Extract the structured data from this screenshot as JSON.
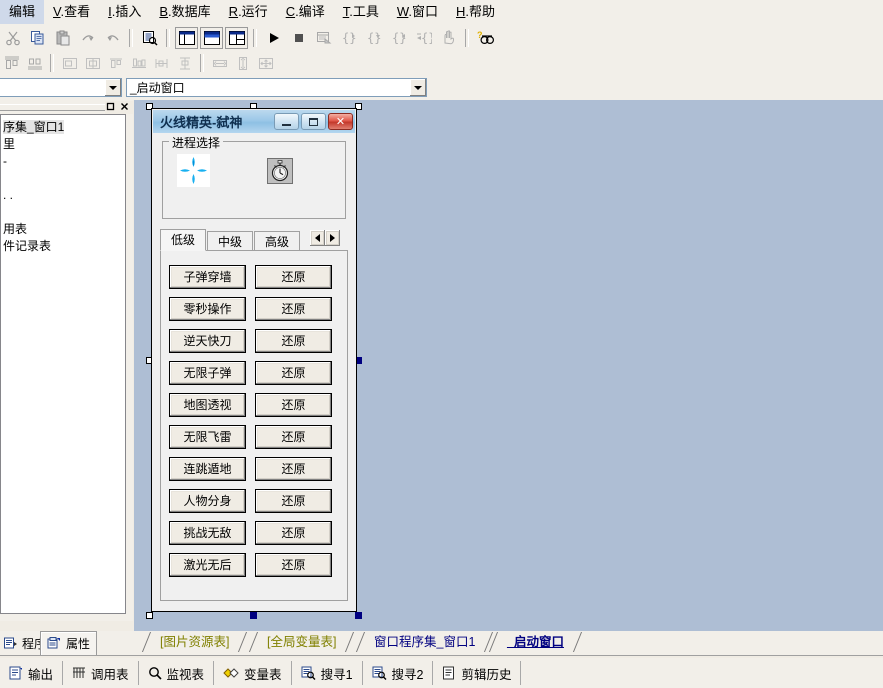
{
  "menu": {
    "items": [
      {
        "mnemonic": "",
        "label": "编辑"
      },
      {
        "mnemonic": "V",
        "label": ".查看"
      },
      {
        "mnemonic": "I",
        "label": ".插入"
      },
      {
        "mnemonic": "B",
        "label": ".数据库"
      },
      {
        "mnemonic": "R",
        "label": ".运行"
      },
      {
        "mnemonic": "C",
        "label": ".编译"
      },
      {
        "mnemonic": "T",
        "label": ".工具"
      },
      {
        "mnemonic": "W",
        "label": ".窗口"
      },
      {
        "mnemonic": "H",
        "label": ".帮助"
      }
    ]
  },
  "toolbar1": {
    "icons": [
      "cut-icon",
      "copy-icon",
      "paste-icon",
      "redo-icon",
      "undo-icon",
      "sep",
      "find-in-file-icon",
      "sep",
      "layout-left-icon",
      "layout-top-icon",
      "layout-grid-icon",
      "sep",
      "run-icon",
      "stop-icon",
      "debug-window-icon",
      "step-into-icon",
      "step-over-icon",
      "step-out-icon",
      "run-to-cursor-icon",
      "pause-hand-icon",
      "sep",
      "find-next-icon"
    ]
  },
  "toolbar2": {
    "icons": [
      "align-tops-icon",
      "align-centers-icon",
      "sep",
      "align-left-icon",
      "align-center-h-icon",
      "align-top-icon",
      "align-bottom-icon",
      "space-h-icon",
      "space-v-icon",
      "sep",
      "same-width-icon",
      "same-height-icon",
      "same-size-icon"
    ]
  },
  "combos": {
    "left": {
      "value": "",
      "placeholder": ""
    },
    "right": {
      "value": "_启动窗口"
    }
  },
  "left_panel": {
    "caption_buttons": [
      "maximize-icon",
      "close-icon"
    ],
    "tree_items": [
      {
        "label": "序集_窗口1",
        "highlight": true
      },
      {
        "label": "里",
        "highlight": false
      },
      {
        "label": "-",
        "highlight": false
      },
      {
        "label": "",
        "highlight": false
      },
      {
        "label": " . .",
        "highlight": false
      },
      {
        "label": "",
        "highlight": false
      },
      {
        "label": "用表",
        "highlight": false
      },
      {
        "label": "件记录表",
        "highlight": false
      }
    ]
  },
  "form": {
    "title": "火线精英-弑神",
    "window_buttons": [
      "minimize-icon",
      "maximize-icon",
      "close-icon"
    ],
    "groupbox_label": "进程选择",
    "groupbox_icons": [
      "process-diamond-icon",
      "stopwatch-icon"
    ],
    "tabs": [
      {
        "label": "低级",
        "active": true
      },
      {
        "label": "中级",
        "active": false
      },
      {
        "label": "高级",
        "active": false
      }
    ],
    "tab_spinner": [
      "spin-left-icon",
      "spin-right-icon"
    ],
    "rows": [
      {
        "action": "子弹穿墙",
        "restore": "还原"
      },
      {
        "action": "零秒操作",
        "restore": "还原"
      },
      {
        "action": "逆天快刀",
        "restore": "还原"
      },
      {
        "action": "无限子弹",
        "restore": "还原"
      },
      {
        "action": "地图透视",
        "restore": "还原"
      },
      {
        "action": "无限飞雷",
        "restore": "还原"
      },
      {
        "action": "连跳遁地",
        "restore": "还原"
      },
      {
        "action": "人物分身",
        "restore": "还原"
      },
      {
        "action": "挑战无敌",
        "restore": "还原"
      },
      {
        "action": "激光无后",
        "restore": "还原"
      }
    ]
  },
  "bottom_left_tabs": [
    {
      "label": "程序",
      "icon": "program-icon",
      "active": false
    },
    {
      "label": "属性",
      "icon": "properties-icon",
      "active": true
    }
  ],
  "document_tabs": [
    {
      "label": "[图片资源表]",
      "color": "#808000",
      "active": false
    },
    {
      "label": "[全局变量表]",
      "color": "#808000",
      "active": false
    },
    {
      "label": "窗口程序集_窗口1",
      "color": "#000080",
      "active": false
    },
    {
      "label": "_启动窗口",
      "color": "#000080",
      "active": true
    }
  ],
  "status_bar": [
    {
      "label": "输出",
      "icon": "output-icon"
    },
    {
      "label": "调用表",
      "icon": "callstack-icon"
    },
    {
      "label": "监视表",
      "icon": "watch-icon"
    },
    {
      "label": "变量表",
      "icon": "variables-icon"
    },
    {
      "label": "搜寻1",
      "icon": "search1-icon"
    },
    {
      "label": "搜寻2",
      "icon": "search2-icon"
    },
    {
      "label": "剪辑历史",
      "icon": "clipboard-history-icon"
    }
  ],
  "colors": {
    "canvas": "#aebed4",
    "chrome": "#f2efe9",
    "title_gradient_start": "#bcd9ee",
    "title_gradient_end": "#8ec0e4",
    "close_button": "#c3392c",
    "active_tab_text": "#000080",
    "resource_tab_text": "#808000"
  }
}
